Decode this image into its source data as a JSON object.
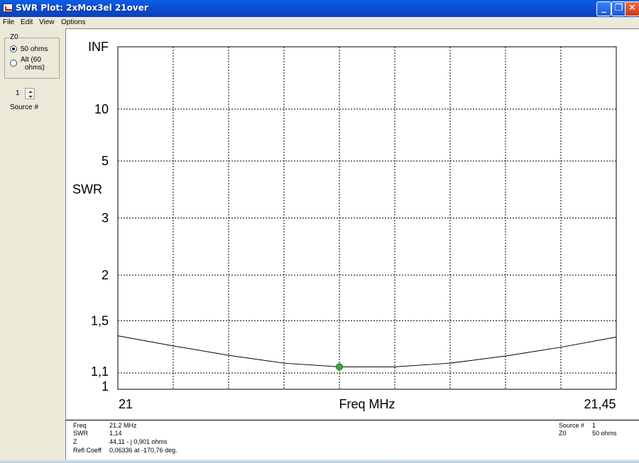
{
  "window": {
    "title": "SWR Plot: 2xMox3el 21over",
    "minimize_icon": "minimize-icon",
    "maximize_icon": "maximize-icon",
    "close_icon": "close-icon"
  },
  "menu": {
    "items": [
      {
        "label": "File"
      },
      {
        "label": "Edit"
      },
      {
        "label": "View"
      },
      {
        "label": "Options"
      }
    ]
  },
  "z0": {
    "group_label": "Z0",
    "option_50": "50 ohms",
    "option_alt_line1": "Alt (60",
    "option_alt_line2": "ohms)",
    "selected": "50 ohms"
  },
  "source": {
    "value": "1",
    "label": "Source #"
  },
  "chart_data": {
    "type": "line",
    "xlabel": "Freq MHz",
    "ylabel": "SWR",
    "x_tick_labels": [
      "21",
      "21,45"
    ],
    "y_tick_labels": [
      "INF",
      "10",
      "5",
      "3",
      "2",
      "1,5",
      "1,1",
      "1"
    ],
    "xlim": [
      21.0,
      21.45
    ],
    "y_scale": "reflection-coefficient",
    "grid": true,
    "series": [
      {
        "x": [
          21.0,
          21.05,
          21.1,
          21.15,
          21.2,
          21.25,
          21.3,
          21.35,
          21.4,
          21.45
        ],
        "values": [
          1.37,
          1.29,
          1.22,
          1.165,
          1.14,
          1.14,
          1.165,
          1.215,
          1.28,
          1.36
        ]
      }
    ],
    "marker": {
      "x": 21.2,
      "y": 1.14,
      "color": "#3aa83a"
    },
    "line_color": "#000000"
  },
  "info": {
    "freq_label": "Freq",
    "freq_value": "21,2 MHz",
    "swr_label": "SWR",
    "swr_value": "1,14",
    "z_label": "Z",
    "z_value": "44,11 - j 0,901 ohms",
    "refl_label": "Refl Coeff",
    "refl_value": "0,06336 at -170,76 deg.",
    "source_label": "Source #",
    "source_value": "1",
    "z0_label": "Z0",
    "z0_value": "50 ohms"
  }
}
